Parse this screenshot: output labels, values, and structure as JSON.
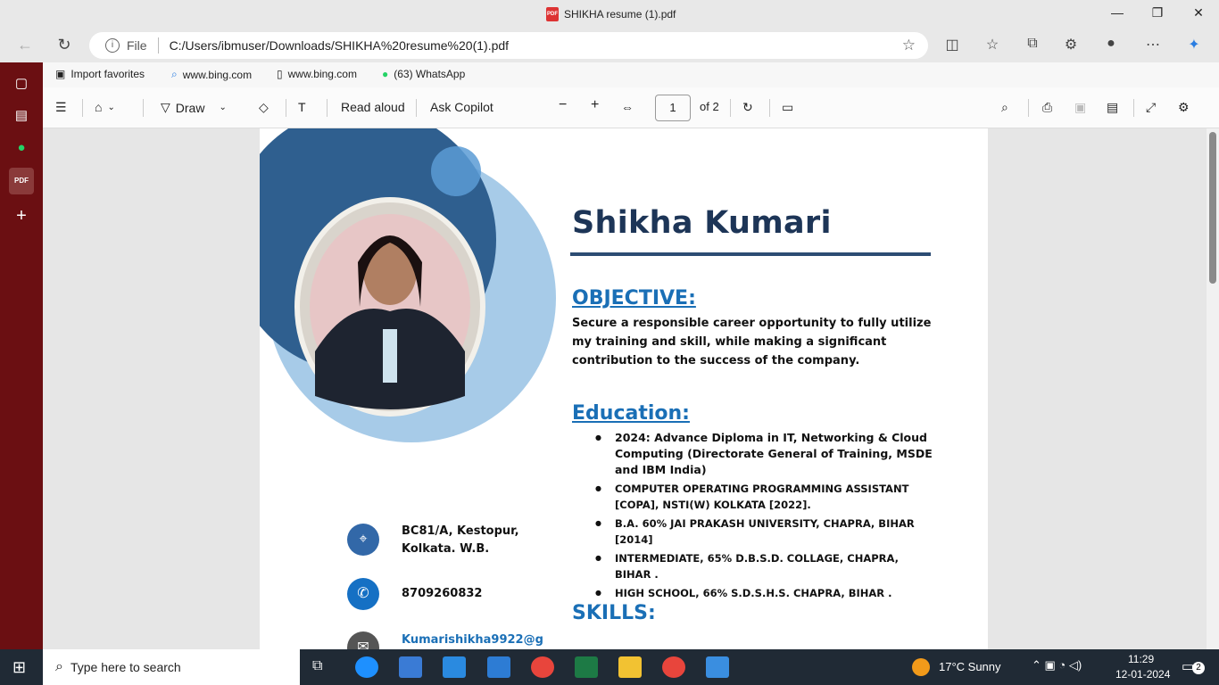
{
  "window": {
    "title": "SHIKHA resume (1).pdf"
  },
  "address": {
    "scheme_label": "File",
    "url": "C:/Users/ibmuser/Downloads/SHIKHA%20resume%20(1).pdf"
  },
  "favorites": [
    {
      "label": "Import favorites"
    },
    {
      "label": "www.bing.com"
    },
    {
      "label": "www.bing.com"
    },
    {
      "label": "(63) WhatsApp"
    }
  ],
  "pdf_toolbar": {
    "draw": "Draw",
    "read_aloud": "Read aloud",
    "ask_copilot": "Ask Copilot",
    "page_current": "1",
    "page_total": "of 2"
  },
  "resume": {
    "name": "Shikha Kumari",
    "objective_heading": "OBJECTIVE:",
    "objective_text": "Secure a responsible career opportunity to fully utilize my training and skill, while making a significant contribution to the success of the company.",
    "education_heading": "Education:",
    "education": [
      "2024: Advance Diploma in IT, Networking & Cloud Computing (Directorate General of Training, MSDE and IBM India)",
      "COMPUTER OPERATING PROGRAMMING ASSISTANT [COPA],  NSTI(W) KOLKATA [2022].",
      "B.A. 60% JAI PRAKASH UNIVERSITY, CHAPRA, BIHAR [2014]",
      "INTERMEDIATE, 65% D.B.S.D. COLLAGE, CHAPRA, BIHAR .",
      "HIGH SCHOOL, 66% S.D.S.H.S. CHAPRA, BIHAR ."
    ],
    "skills_heading": "SKILLS:",
    "address_line1": "BC81/A, Kestopur,",
    "address_line2": "Kolkata. W.B.",
    "phone": "8709260832",
    "email": "Kumarishikha9922@g"
  },
  "taskbar": {
    "search_placeholder": "Type here to search",
    "weather": "17°C  Sunny",
    "time": "11:29",
    "date": "12-01-2024",
    "notification_count": "2"
  }
}
